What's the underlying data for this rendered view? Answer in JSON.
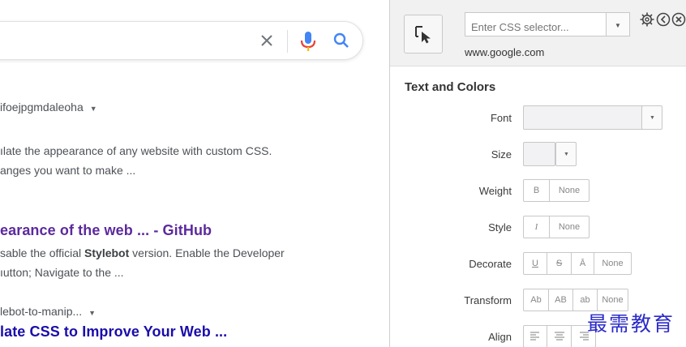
{
  "search": {
    "icons": [
      "close-icon",
      "mic-icon",
      "search-icon"
    ]
  },
  "results": [
    {
      "url": "ifoejpgmdaleoha",
      "snippet_lines": [
        "ılate the appearance of any website with custom CSS.",
        "anges you want to make ..."
      ]
    },
    {
      "title": "earance of the web ... - GitHub",
      "snippet_line1_pre": "sable the official ",
      "snippet_line1_bold": "Stylebot",
      "snippet_line1_post": " version. Enable the Developer",
      "snippet_line2": "ıutton; Navigate to the ..."
    },
    {
      "url": "lebot-to-manip...",
      "title": "late CSS to Improve Your Web ..."
    }
  ],
  "panel": {
    "selector_placeholder": "Enter CSS selector...",
    "site": "www.google.com",
    "section_title": "Text and Colors",
    "properties": {
      "font": "Font",
      "size": "Size",
      "weight": "Weight",
      "style": "Style",
      "decorate": "Decorate",
      "transform": "Transform",
      "align": "Align"
    },
    "weight_buttons": [
      "B",
      "None"
    ],
    "style_buttons": [
      "I",
      "None"
    ],
    "decorate_buttons": [
      "U",
      "S",
      "Ā",
      "None"
    ],
    "transform_buttons": [
      "Ab",
      "AB",
      "ab",
      "None"
    ],
    "align_buttons": [
      "align-left-icon",
      "align-center-icon",
      "align-right-icon"
    ]
  },
  "watermark": "最需教育",
  "colors": {
    "visited_link": "#5c2a9d",
    "link": "#1a0dab",
    "mic_blue": "#4285f4",
    "mic_red": "#ea4335"
  }
}
